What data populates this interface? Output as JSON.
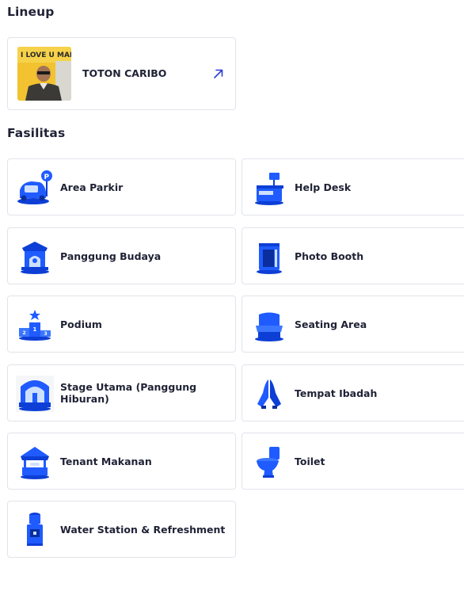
{
  "lineup": {
    "title": "Lineup",
    "items": [
      {
        "name": "TOTON CARIBO",
        "thumb_text": "I LOVE U MAMA",
        "icon": "external-link-arrow-icon"
      }
    ]
  },
  "fasilitas": {
    "title": "Fasilitas",
    "items": [
      {
        "label": "Area Parkir",
        "icon": "parking-icon"
      },
      {
        "label": "Help Desk",
        "icon": "help-desk-icon"
      },
      {
        "label": "Panggung Budaya",
        "icon": "cultural-stage-icon"
      },
      {
        "label": "Photo Booth",
        "icon": "photo-booth-icon"
      },
      {
        "label": "Podium",
        "icon": "podium-icon"
      },
      {
        "label": "Seating Area",
        "icon": "seating-icon"
      },
      {
        "label": "Stage Utama (Panggung Hiburan)",
        "icon": "main-stage-icon"
      },
      {
        "label": "Tempat Ibadah",
        "icon": "prayer-icon"
      },
      {
        "label": "Tenant Makanan",
        "icon": "food-tenant-icon"
      },
      {
        "label": "Toilet",
        "icon": "toilet-icon"
      },
      {
        "label": "Water Station & Refreshment",
        "icon": "water-station-icon"
      }
    ]
  },
  "colors": {
    "accent": "#1f5bff",
    "accent_dark": "#0d3fd6",
    "arrow": "#2b3fd1",
    "border": "#e1e4ea"
  }
}
